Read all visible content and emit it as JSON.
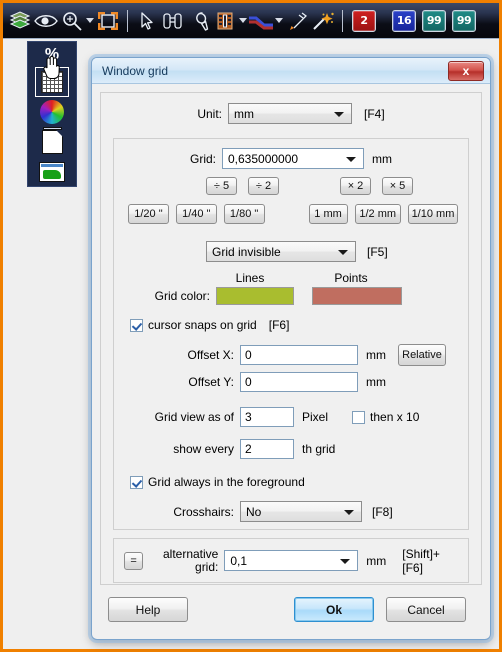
{
  "toolbar": {
    "icons": [
      {
        "name": "layers-icon",
        "label": "Layers"
      },
      {
        "name": "eye-icon",
        "label": "View"
      },
      {
        "name": "zoom-icon",
        "label": "Zoom"
      },
      {
        "name": "fit-window-icon",
        "label": "Fit to window"
      },
      {
        "name": "pointer-icon",
        "label": "Select"
      },
      {
        "name": "binoculars-icon",
        "label": "Find"
      },
      {
        "name": "wrench-icon",
        "label": "Tools"
      },
      {
        "name": "chip-icon",
        "label": "Component"
      },
      {
        "name": "trace-icon",
        "label": "Trace"
      },
      {
        "name": "pen-icon",
        "label": "Draw"
      },
      {
        "name": "magic-wand-icon",
        "label": "Autoroute"
      }
    ],
    "badges": [
      {
        "name": "layer-count-badge",
        "text": "2",
        "color": "#c01c1c"
      },
      {
        "name": "signal-count-badge",
        "text": "16",
        "color": "#2436b4"
      },
      {
        "name": "net-count-badge-1",
        "text": "99",
        "color": "#1b7b78"
      },
      {
        "name": "net-count-badge-2",
        "text": "99",
        "color": "#1b7b78"
      }
    ]
  },
  "palette": {
    "percent_label": "%",
    "items": [
      {
        "name": "grid-tool",
        "label": "Grid"
      },
      {
        "name": "color-wheel-tool",
        "label": "Colors"
      },
      {
        "name": "document-tool",
        "label": "Document"
      },
      {
        "name": "screen-tool",
        "label": "Screen"
      }
    ]
  },
  "dialog": {
    "title": "Window grid",
    "close_label": "x",
    "unit": {
      "label": "Unit:",
      "value": "mm",
      "hotkey": "[F4]"
    },
    "grid": {
      "label": "Grid:",
      "value": "0,635000000",
      "unit": "mm",
      "divide_buttons": [
        "÷ 5",
        "÷ 2"
      ],
      "multiply_buttons": [
        "× 2",
        "× 5"
      ],
      "inch_presets": [
        "1/20 \"",
        "1/40 \"",
        "1/80 \""
      ],
      "mm_presets": [
        "1 mm",
        "1/2 mm",
        "1/10 mm"
      ]
    },
    "visibility": {
      "value": "Grid invisible",
      "hotkey": "[F5]"
    },
    "grid_color": {
      "label": "Grid color:",
      "lines_label": "Lines",
      "points_label": "Points",
      "lines_color": "#a9bd2f",
      "points_color": "#c06e60"
    },
    "snap": {
      "label": "cursor snaps on grid",
      "hotkey": "[F6]",
      "checked": true
    },
    "offset_x": {
      "label": "Offset X:",
      "value": "0",
      "unit": "mm"
    },
    "offset_y": {
      "label": "Offset Y:",
      "value": "0",
      "unit": "mm"
    },
    "relative_button": "Relative",
    "grid_view": {
      "label": "Grid view as of",
      "value": "3",
      "unit": "Pixel",
      "then_label": "then x 10",
      "then_checked": false
    },
    "show_every": {
      "label": "show every",
      "value": "2",
      "suffix": "th  grid"
    },
    "foreground": {
      "label": "Grid always in the foreground",
      "checked": true
    },
    "crosshairs": {
      "label": "Crosshairs:",
      "value": "No",
      "hotkey": "[F8]"
    },
    "alternative": {
      "equals_button": "=",
      "label_line1": "alternative",
      "label_line2": "grid:",
      "value": "0,1",
      "unit": "mm",
      "hotkey": "[Shift]+[F6]"
    },
    "buttons": {
      "help": "Help",
      "ok": "Ok",
      "cancel": "Cancel"
    }
  }
}
